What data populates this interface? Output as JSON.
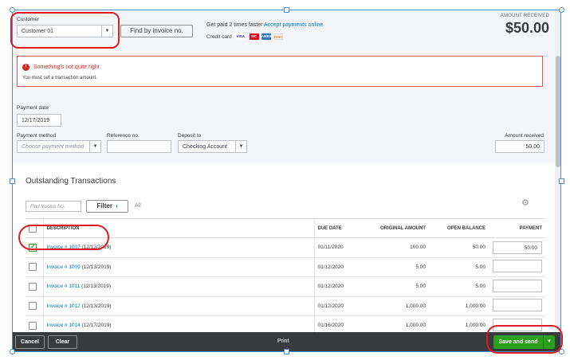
{
  "customer": {
    "label": "Customer",
    "value": "Customer 01",
    "find_by_invoice_label": "Find by invoice no."
  },
  "promo": {
    "prefix": "Get paid 2 times faster",
    "link": "Accept payments online",
    "credit_card_label": "Credit card",
    "cards": [
      "VISA",
      "MC",
      "AMEX",
      "DISC"
    ]
  },
  "amount_received_header": {
    "label": "AMOUNT RECEIVED",
    "value": "$50.00"
  },
  "error": {
    "icon": "!",
    "title": "Something's not quite right",
    "message": "You must set a transaction amount."
  },
  "payment_date": {
    "label": "Payment date",
    "value": "12/17/2019"
  },
  "payment_method": {
    "label": "Payment method",
    "placeholder": "Choose payment method"
  },
  "reference": {
    "label": "Reference no.",
    "value": ""
  },
  "deposit_to": {
    "label": "Deposit to",
    "value": "Checking Account"
  },
  "amount_received": {
    "label": "Amount received",
    "value": "50.00"
  },
  "outstanding": {
    "title": "Outstanding Transactions",
    "find_placeholder": "Find Invoice No.",
    "filter_label": "Filter",
    "all_label": "All",
    "columns": {
      "description": "DESCRIPTION",
      "due_date": "DUE DATE",
      "original_amount": "ORIGINAL AMOUNT",
      "open_balance": "OPEN BALANCE",
      "payment": "PAYMENT"
    },
    "rows": [
      {
        "checked": true,
        "link": "Invoice # 1007",
        "date": "(12/12/2019)",
        "due": "01/11/2020",
        "original": "100.00",
        "open": "50.00",
        "payment": "50.00"
      },
      {
        "checked": false,
        "link": "Invoice # 1009",
        "date": "(12/13/2019)",
        "due": "01/12/2020",
        "original": "5.00",
        "open": "5.00",
        "payment": ""
      },
      {
        "checked": false,
        "link": "Invoice # 1011",
        "date": "(12/13/2019)",
        "due": "01/12/2020",
        "original": "5.00",
        "open": "5.00",
        "payment": ""
      },
      {
        "checked": false,
        "link": "Invoice # 1012",
        "date": "(12/13/2019)",
        "due": "01/12/2020",
        "original": "1,000.00",
        "open": "1,000.00",
        "payment": ""
      },
      {
        "checked": false,
        "link": "Invoice # 1014",
        "date": "(12/17/2019)",
        "due": "01/16/2020",
        "original": "1,000.00",
        "open": "1,000.00",
        "payment": ""
      }
    ]
  },
  "footer": {
    "cancel": "Cancel",
    "clear": "Clear",
    "print": "Print",
    "save_and_send": "Save and send"
  }
}
